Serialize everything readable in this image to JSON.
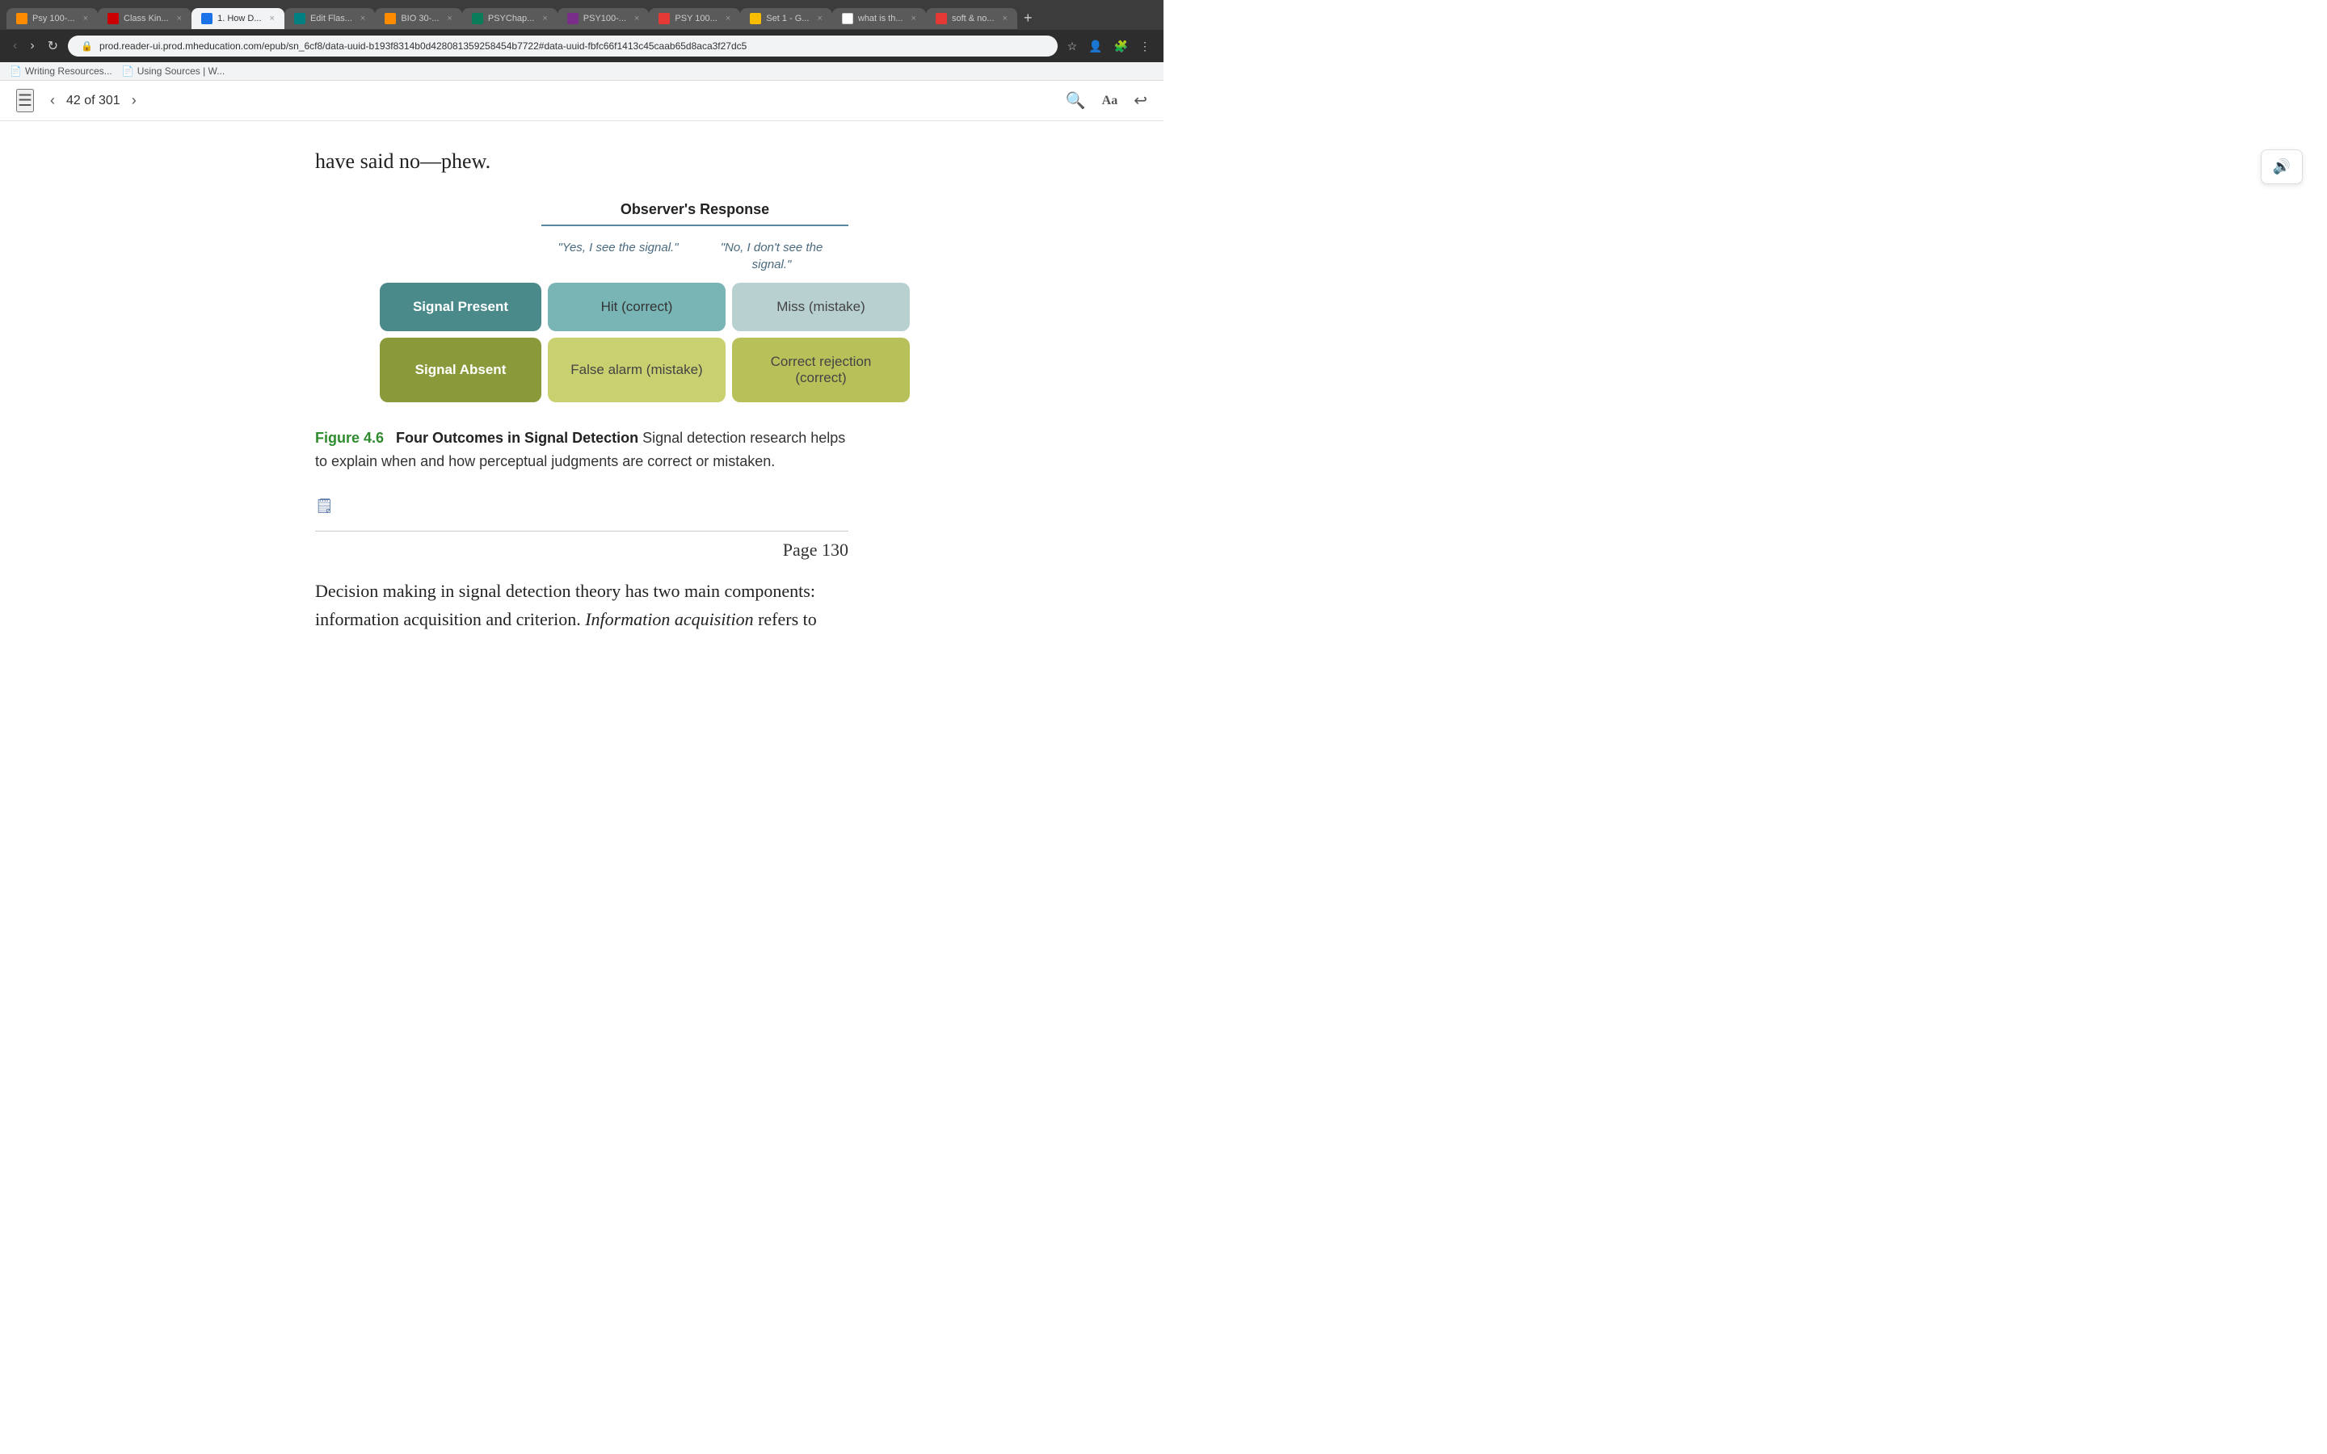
{
  "browser": {
    "tabs": [
      {
        "id": "tab1",
        "title": "Psy 100-...",
        "active": false,
        "favicon": "orange"
      },
      {
        "id": "tab2",
        "title": "Class Kin...",
        "active": false,
        "favicon": "red"
      },
      {
        "id": "tab3",
        "title": "1. How D...",
        "active": true,
        "favicon": "blue"
      },
      {
        "id": "tab4",
        "title": "Edit Flas...",
        "active": false,
        "favicon": "teal"
      },
      {
        "id": "tab5",
        "title": "BIO 30-...",
        "active": false,
        "favicon": "orange"
      },
      {
        "id": "tab6",
        "title": "PSYChap...",
        "active": false,
        "favicon": "green"
      },
      {
        "id": "tab7",
        "title": "PSY100-...",
        "active": false,
        "favicon": "purple"
      },
      {
        "id": "tab8",
        "title": "PSY 100...",
        "active": false,
        "favicon": "red2"
      },
      {
        "id": "tab9",
        "title": "Set 1 - G...",
        "active": false,
        "favicon": "yellow"
      },
      {
        "id": "tab10",
        "title": "what is th...",
        "active": false,
        "favicon": "white"
      },
      {
        "id": "tab11",
        "title": "soft & no...",
        "active": false,
        "favicon": "red2"
      }
    ],
    "url": "prod.reader-ui.prod.mheducation.com/epub/sn_6cf8/data-uuid-b193f8314b0d428081359258454b7722#data-uuid-fbfc66f1413c45caab65d8aca3f27dc5",
    "bookmarks": [
      {
        "label": "Writing Resources...",
        "icon": "📄"
      },
      {
        "label": "Using Sources | W...",
        "icon": "📄"
      }
    ]
  },
  "reader": {
    "toc_icon": "☰",
    "page_current": "42",
    "page_total": "301",
    "nav_prev": "‹",
    "nav_next": "›",
    "search_icon": "🔍",
    "font_icon": "Aa",
    "back_icon": "↩"
  },
  "content": {
    "intro_text": "have said no—phew.",
    "table": {
      "observer_response_header": "Observer's Response",
      "yes_header": "\"Yes, I see the signal.\"",
      "no_header": "\"No, I don't see the signal.\"",
      "signal_present_label": "Signal Present",
      "signal_absent_label": "Signal Absent",
      "hit_label": "Hit (correct)",
      "miss_label": "Miss (mistake)",
      "false_alarm_label": "False alarm (mistake)",
      "correct_rejection_label": "Correct rejection (correct)"
    },
    "figure_label": "Figure 4.6",
    "figure_title": "Four Outcomes in Signal Detection",
    "figure_caption": "Signal detection research helps to explain when and how perceptual judgments are correct or mistaken.",
    "page_number": "Page  130",
    "bottom_text_1": "Decision making in signal detection theory has two main components:",
    "bottom_text_2": "information acquisition and criterion.",
    "bottom_text_italic": "Information acquisition"
  },
  "sound_button_icon": "🔊"
}
